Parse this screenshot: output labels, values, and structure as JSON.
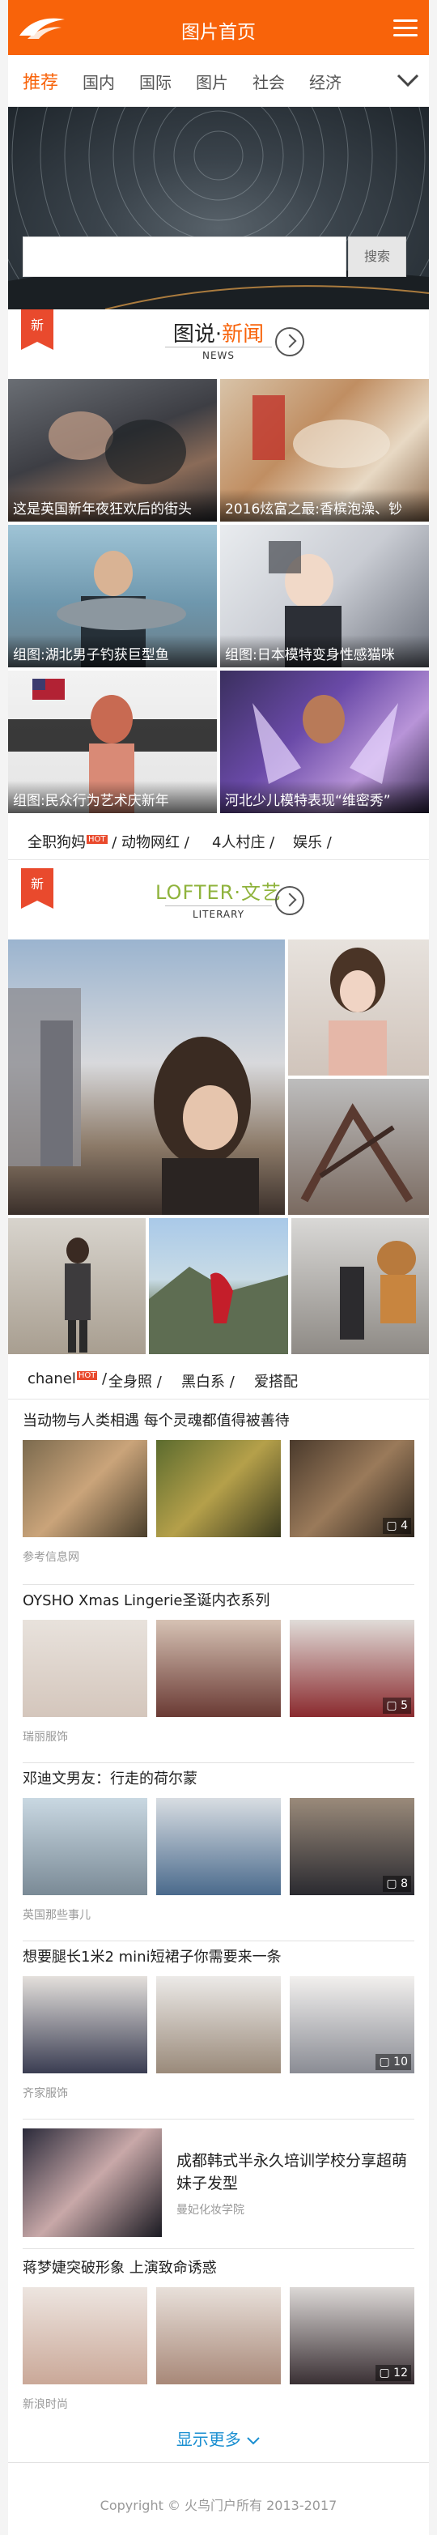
{
  "header": {
    "title": "图片首页",
    "logo_icon": "bird-logo-icon",
    "menu_icon": "hamburger-icon"
  },
  "nav": {
    "items": [
      "推荐",
      "国内",
      "国际",
      "图片",
      "社会",
      "经济"
    ],
    "active_index": 0,
    "expand_icon": "chevron-down-icon"
  },
  "search": {
    "placeholder": "",
    "button_label": "搜索"
  },
  "news_section": {
    "badge": "新",
    "title_part1": "图说·",
    "title_part2": "新闻",
    "subtitle": "NEWS",
    "arrow_icon": "circle-arrow-right-icon",
    "captions": [
      "这是英国新年夜狂欢后的街头",
      "2016炫富之最:香槟泡澡、钞",
      "组图:湖北男子钓获巨型鱼",
      "组图:日本模特变身性感猫咪",
      "组图:民众行为艺术庆新年",
      "河北少儿模特表现“维密秀”"
    ],
    "tags": [
      "全职狗妈",
      "动物网红",
      "4人村庄",
      "娱乐"
    ],
    "tag_badge": "HOT"
  },
  "literary_section": {
    "badge": "新",
    "title_part1": "LOFTER·",
    "title_part2": "文艺",
    "subtitle": "LITERARY",
    "arrow_icon": "circle-arrow-right-icon",
    "tags": [
      "chanel",
      "全身照",
      "黑白系",
      "爱搭配"
    ],
    "tag_badge": "HOT"
  },
  "articles": [
    {
      "title": "当动物与人类相遇 每个灵魂都值得被善待",
      "source": "参考信息网",
      "count": "4"
    },
    {
      "title": "OYSHO Xmas Lingerie圣诞内衣系列",
      "source": "瑞丽服饰",
      "count": "5"
    },
    {
      "title": "邓迪文男友：行走的荷尔蒙",
      "source": "英国那些事儿",
      "count": "8"
    },
    {
      "title": "想要腿长1米2 mini短裙子你需要来一条",
      "source": "齐家服饰",
      "count": "10"
    }
  ],
  "feature": {
    "title": "成都韩式半永久培训学校分享超萌妹子发型",
    "source": "曼妃化妆学院"
  },
  "last_article": {
    "title": "蒋梦婕突破形象 上演致命诱惑",
    "source": "新浪时尚",
    "count": "12"
  },
  "more_label": "显示更多",
  "footer": "Copyright © 火鸟门户所有 2013-2017",
  "colors": {
    "brand": "#f8630a",
    "badge": "#e94a2d",
    "link": "#1a8fd1"
  }
}
